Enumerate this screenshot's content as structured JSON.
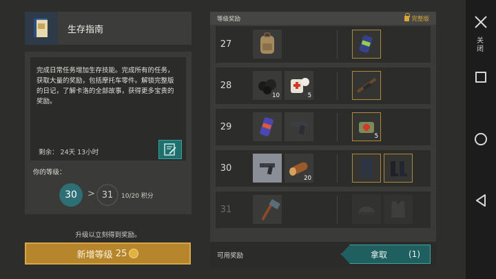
{
  "book": {
    "title": "生存指南",
    "icon": "book-icon"
  },
  "description": {
    "text": "完成日常任务增加生存技能。完成所有的任务，获取大量的奖励，包括摩托车零件。解锁完整版的日记，了解卡洛的全部故事，获得更多宝贵的奖励。",
    "remaining": "剩余： 24天 13小时"
  },
  "level": {
    "label": "你的等级：",
    "current": "30",
    "arrow": ">",
    "next": "31",
    "points": "10/20 积分"
  },
  "upgrade_hint": "升级以立刻得到奖励。",
  "buy_button": {
    "label": "新增等级",
    "price": "25"
  },
  "rewards": {
    "title": "等级奖励",
    "full_version": "完整版",
    "rows": [
      {
        "level": "27",
        "free": [
          {
            "icon": "backpack-icon",
            "qty": ""
          }
        ],
        "premium": [
          {
            "icon": "energy-drink-icon",
            "qty": ""
          }
        ]
      },
      {
        "level": "28",
        "free": [
          {
            "icon": "coal-icon",
            "qty": "10"
          },
          {
            "icon": "medkit-icon",
            "qty": "5"
          }
        ],
        "premium": [
          {
            "icon": "rifle-icon",
            "qty": ""
          }
        ]
      },
      {
        "level": "29",
        "free": [
          {
            "icon": "energy-drink-icon",
            "qty": ""
          },
          {
            "icon": "pistol-icon",
            "qty": ""
          }
        ],
        "premium": [
          {
            "icon": "medical-bag-icon",
            "qty": "5"
          }
        ]
      },
      {
        "level": "30",
        "free": [
          {
            "icon": "pistol-blueprint-icon",
            "qty": ""
          },
          {
            "icon": "wood-log-icon",
            "qty": "20"
          }
        ],
        "premium": [
          {
            "icon": "pants-icon",
            "qty": ""
          },
          {
            "icon": "boots-icon",
            "qty": ""
          }
        ]
      },
      {
        "level": "31",
        "free": [
          {
            "icon": "sledgehammer-icon",
            "qty": ""
          }
        ],
        "premium": [
          {
            "icon": "helmet-icon",
            "qty": ""
          },
          {
            "icon": "armor-vest-icon",
            "qty": ""
          }
        ]
      }
    ],
    "available_label": "可用奖励",
    "claim_label": "拿取",
    "claim_count": "(1)"
  },
  "navbar": {
    "close_label": "关闭"
  },
  "colors": {
    "accent_teal": "#2d6f74",
    "gold": "#b7862c",
    "premium_border": "#b08a3a"
  }
}
